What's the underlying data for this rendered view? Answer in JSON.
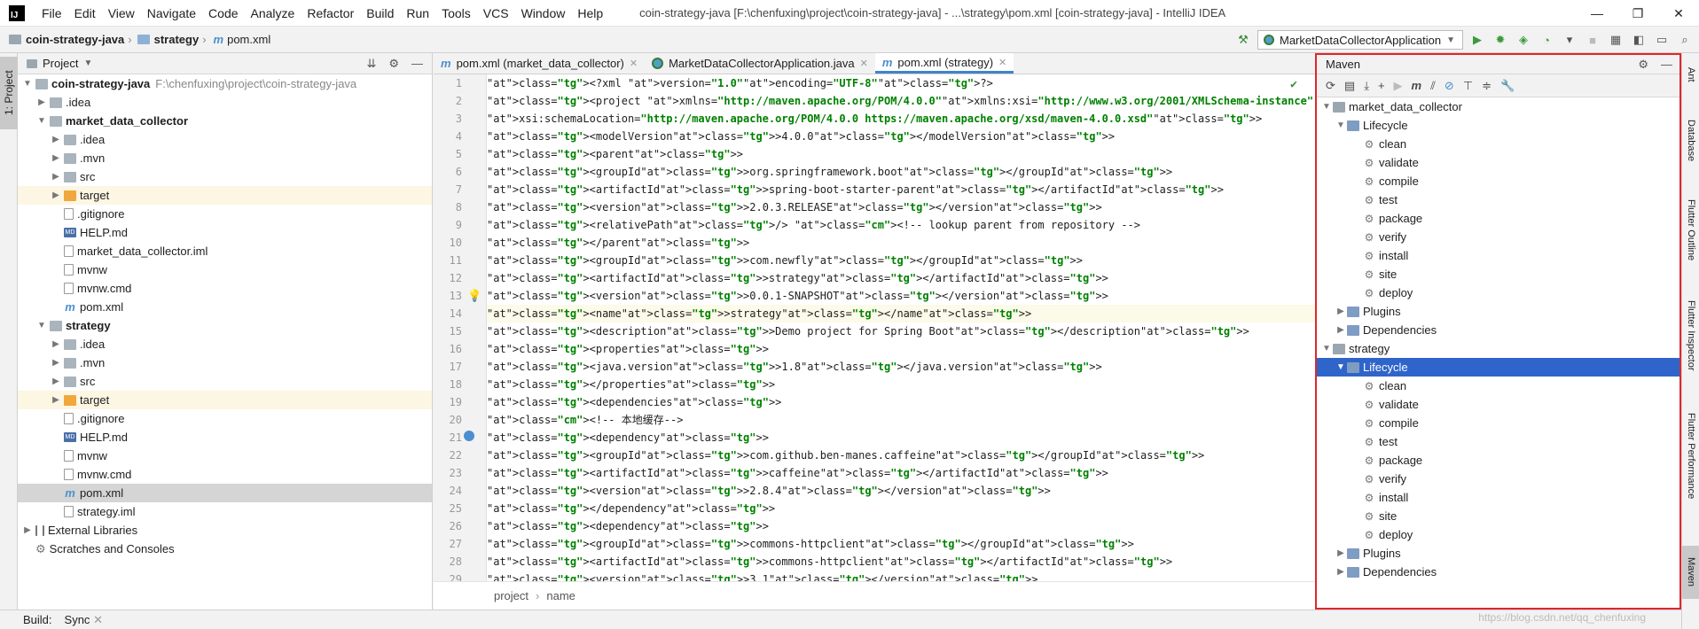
{
  "window": {
    "app_logo": "IJ",
    "menu": [
      "File",
      "Edit",
      "View",
      "Navigate",
      "Code",
      "Analyze",
      "Refactor",
      "Build",
      "Run",
      "Tools",
      "VCS",
      "Window",
      "Help"
    ],
    "title": "coin-strategy-java [F:\\chenfuxing\\project\\coin-strategy-java] - ...\\strategy\\pom.xml [coin-strategy-java] - IntelliJ IDEA",
    "controls": [
      "—",
      "❐",
      "✕"
    ]
  },
  "navbar": {
    "crumbs": [
      "coin-strategy-java",
      "strategy",
      "pom.xml"
    ],
    "run_config": "MarketDataCollectorApplication"
  },
  "left_strip": {
    "tab": "1: Project"
  },
  "project_panel": {
    "title": "Project",
    "rows": [
      {
        "label": "coin-strategy-java",
        "path": "F:\\chenfuxing\\project\\coin-strategy-java",
        "bold": true
      },
      {
        "label": ".idea"
      },
      {
        "label": "market_data_collector",
        "bold": true
      },
      {
        "label": ".idea"
      },
      {
        "label": ".mvn"
      },
      {
        "label": "src"
      },
      {
        "label": "target"
      },
      {
        "label": ".gitignore"
      },
      {
        "label": "HELP.md"
      },
      {
        "label": "market_data_collector.iml"
      },
      {
        "label": "mvnw"
      },
      {
        "label": "mvnw.cmd"
      },
      {
        "label": "pom.xml"
      },
      {
        "label": "strategy",
        "bold": true
      },
      {
        "label": ".idea"
      },
      {
        "label": ".mvn"
      },
      {
        "label": "src"
      },
      {
        "label": "target"
      },
      {
        "label": ".gitignore"
      },
      {
        "label": "HELP.md"
      },
      {
        "label": "mvnw"
      },
      {
        "label": "mvnw.cmd"
      },
      {
        "label": "pom.xml"
      },
      {
        "label": "strategy.iml"
      },
      {
        "label": "External Libraries"
      },
      {
        "label": "Scratches and Consoles"
      }
    ]
  },
  "editor": {
    "tabs": [
      "pom.xml (market_data_collector)",
      "MarketDataCollectorApplication.java",
      "pom.xml (strategy)"
    ],
    "line_numbers": [
      "1",
      "2",
      "3",
      "4",
      "5",
      "6",
      "7",
      "8",
      "9",
      "10",
      "11",
      "12",
      "13",
      "14",
      "15",
      "16",
      "17",
      "18",
      "19",
      "20",
      "21",
      "22",
      "23",
      "24",
      "25",
      "26",
      "27",
      "28",
      "29"
    ],
    "lines": [
      "<?xml version=\"1.0\" encoding=\"UTF-8\"?>",
      "<project xmlns=\"http://maven.apache.org/POM/4.0.0\" xmlns:xsi=\"http://www.w3.org/2001/XMLSchema-instance\"",
      "         xsi:schemaLocation=\"http://maven.apache.org/POM/4.0.0 https://maven.apache.org/xsd/maven-4.0.0.xsd\">",
      "    <modelVersion>4.0.0</modelVersion>",
      "    <parent>",
      "        <groupId>org.springframework.boot</groupId>",
      "        <artifactId>spring-boot-starter-parent</artifactId>",
      "        <version>2.0.3.RELEASE</version>",
      "        <relativePath/> <!-- lookup parent from repository -->",
      "    </parent>",
      "    <groupId>com.newfly</groupId>",
      "    <artifactId>strategy</artifactId>",
      "    <version>0.0.1-SNAPSHOT</version>",
      "    <name>strategy</name>",
      "    <description>Demo project for Spring Boot</description>",
      "    <properties>",
      "        <java.version>1.8</java.version>",
      "    </properties>",
      "    <dependencies>",
      "        <!-- 本地缓存-->",
      "        <dependency>",
      "            <groupId>com.github.ben-manes.caffeine</groupId>",
      "            <artifactId>caffeine</artifactId>",
      "            <version>2.8.4</version>",
      "        </dependency>",
      "        <dependency>",
      "            <groupId>commons-httpclient</groupId>",
      "            <artifactId>commons-httpclient</artifactId>",
      "            <version>3.1</version>"
    ],
    "breadcrumb": [
      "project",
      "name"
    ]
  },
  "maven": {
    "title": "Maven",
    "rows": [
      {
        "label": "market_data_collector"
      },
      {
        "label": "Lifecycle"
      },
      {
        "label": "clean"
      },
      {
        "label": "validate"
      },
      {
        "label": "compile"
      },
      {
        "label": "test"
      },
      {
        "label": "package"
      },
      {
        "label": "verify"
      },
      {
        "label": "install"
      },
      {
        "label": "site"
      },
      {
        "label": "deploy"
      },
      {
        "label": "Plugins"
      },
      {
        "label": "Dependencies"
      },
      {
        "label": "strategy"
      },
      {
        "label": "Lifecycle"
      },
      {
        "label": "clean"
      },
      {
        "label": "validate"
      },
      {
        "label": "compile"
      },
      {
        "label": "test"
      },
      {
        "label": "package"
      },
      {
        "label": "verify"
      },
      {
        "label": "install"
      },
      {
        "label": "site"
      },
      {
        "label": "deploy"
      },
      {
        "label": "Plugins"
      },
      {
        "label": "Dependencies"
      }
    ]
  },
  "right_strip": [
    "Ant",
    "Database",
    "Flutter Outline",
    "Flutter Inspector",
    "Flutter Performance",
    "Maven"
  ],
  "statusbar": {
    "items": [
      "Build:",
      "Sync"
    ]
  },
  "watermark": "https://blog.csdn.net/qq_chenfuxing"
}
